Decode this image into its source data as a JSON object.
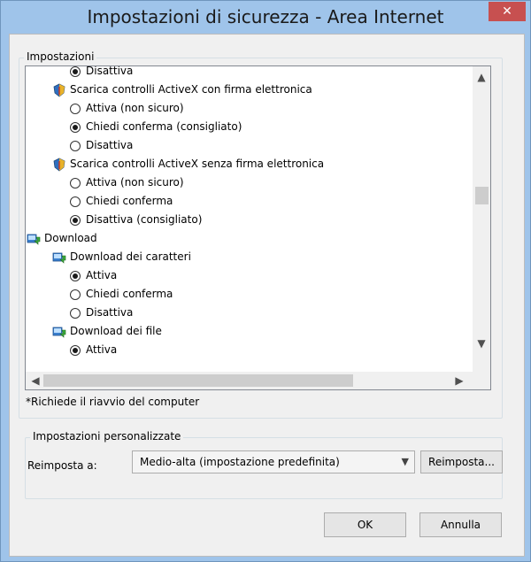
{
  "window": {
    "title": "Impostazioni di sicurezza - Area Internet",
    "close_glyph": "✕"
  },
  "settings_group": {
    "label": "Impostazioni",
    "rows": [
      {
        "type": "radio",
        "indent": 1,
        "checked": true,
        "label": "Disattiva"
      },
      {
        "type": "category",
        "indent": 0,
        "icon": "shield-icon",
        "label": "Scarica controlli ActiveX con firma elettronica"
      },
      {
        "type": "radio",
        "indent": 1,
        "checked": false,
        "label": "Attiva (non sicuro)"
      },
      {
        "type": "radio",
        "indent": 1,
        "checked": true,
        "label": "Chiedi conferma (consigliato)"
      },
      {
        "type": "radio",
        "indent": 1,
        "checked": false,
        "label": "Disattiva"
      },
      {
        "type": "category",
        "indent": 0,
        "icon": "shield-icon",
        "label": "Scarica controlli ActiveX senza firma elettronica"
      },
      {
        "type": "radio",
        "indent": 1,
        "checked": false,
        "label": "Attiva (non sicuro)"
      },
      {
        "type": "radio",
        "indent": 1,
        "checked": false,
        "label": "Chiedi conferma"
      },
      {
        "type": "radio",
        "indent": 1,
        "checked": true,
        "label": "Disattiva (consigliato)"
      },
      {
        "type": "category",
        "indent": -1,
        "icon": "download-icon",
        "label": "Download"
      },
      {
        "type": "category",
        "indent": 0,
        "icon": "download-icon",
        "label": "Download dei caratteri"
      },
      {
        "type": "radio",
        "indent": 1,
        "checked": true,
        "label": "Attiva"
      },
      {
        "type": "radio",
        "indent": 1,
        "checked": false,
        "label": "Chiedi conferma"
      },
      {
        "type": "radio",
        "indent": 1,
        "checked": false,
        "label": "Disattiva"
      },
      {
        "type": "category",
        "indent": 0,
        "icon": "download-icon",
        "label": "Download dei file"
      },
      {
        "type": "radio",
        "indent": 1,
        "checked": true,
        "label": "Attiva"
      }
    ]
  },
  "note": "*Richiede il riavvio del computer",
  "custom_group": {
    "label": "Impostazioni personalizzate",
    "reset_label": "Reimposta a:",
    "reset_value": "Medio-alta (impostazione predefinita)",
    "reset_button": "Reimposta..."
  },
  "footer": {
    "ok": "OK",
    "cancel": "Annulla"
  },
  "colors": {
    "frame": "#9fc4ea",
    "close_button": "#c75050",
    "client_bg": "#f0f0f0"
  }
}
